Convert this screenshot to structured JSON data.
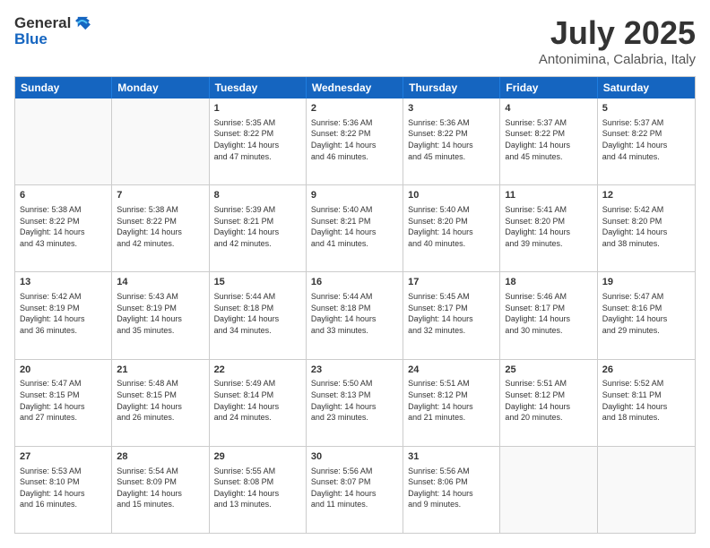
{
  "header": {
    "logo_line1": "General",
    "logo_line2": "Blue",
    "month": "July 2025",
    "location": "Antonimina, Calabria, Italy"
  },
  "days_of_week": [
    "Sunday",
    "Monday",
    "Tuesday",
    "Wednesday",
    "Thursday",
    "Friday",
    "Saturday"
  ],
  "weeks": [
    [
      {
        "day": "",
        "info": ""
      },
      {
        "day": "",
        "info": ""
      },
      {
        "day": "1",
        "info": "Sunrise: 5:35 AM\nSunset: 8:22 PM\nDaylight: 14 hours\nand 47 minutes."
      },
      {
        "day": "2",
        "info": "Sunrise: 5:36 AM\nSunset: 8:22 PM\nDaylight: 14 hours\nand 46 minutes."
      },
      {
        "day": "3",
        "info": "Sunrise: 5:36 AM\nSunset: 8:22 PM\nDaylight: 14 hours\nand 45 minutes."
      },
      {
        "day": "4",
        "info": "Sunrise: 5:37 AM\nSunset: 8:22 PM\nDaylight: 14 hours\nand 45 minutes."
      },
      {
        "day": "5",
        "info": "Sunrise: 5:37 AM\nSunset: 8:22 PM\nDaylight: 14 hours\nand 44 minutes."
      }
    ],
    [
      {
        "day": "6",
        "info": "Sunrise: 5:38 AM\nSunset: 8:22 PM\nDaylight: 14 hours\nand 43 minutes."
      },
      {
        "day": "7",
        "info": "Sunrise: 5:38 AM\nSunset: 8:22 PM\nDaylight: 14 hours\nand 42 minutes."
      },
      {
        "day": "8",
        "info": "Sunrise: 5:39 AM\nSunset: 8:21 PM\nDaylight: 14 hours\nand 42 minutes."
      },
      {
        "day": "9",
        "info": "Sunrise: 5:40 AM\nSunset: 8:21 PM\nDaylight: 14 hours\nand 41 minutes."
      },
      {
        "day": "10",
        "info": "Sunrise: 5:40 AM\nSunset: 8:20 PM\nDaylight: 14 hours\nand 40 minutes."
      },
      {
        "day": "11",
        "info": "Sunrise: 5:41 AM\nSunset: 8:20 PM\nDaylight: 14 hours\nand 39 minutes."
      },
      {
        "day": "12",
        "info": "Sunrise: 5:42 AM\nSunset: 8:20 PM\nDaylight: 14 hours\nand 38 minutes."
      }
    ],
    [
      {
        "day": "13",
        "info": "Sunrise: 5:42 AM\nSunset: 8:19 PM\nDaylight: 14 hours\nand 36 minutes."
      },
      {
        "day": "14",
        "info": "Sunrise: 5:43 AM\nSunset: 8:19 PM\nDaylight: 14 hours\nand 35 minutes."
      },
      {
        "day": "15",
        "info": "Sunrise: 5:44 AM\nSunset: 8:18 PM\nDaylight: 14 hours\nand 34 minutes."
      },
      {
        "day": "16",
        "info": "Sunrise: 5:44 AM\nSunset: 8:18 PM\nDaylight: 14 hours\nand 33 minutes."
      },
      {
        "day": "17",
        "info": "Sunrise: 5:45 AM\nSunset: 8:17 PM\nDaylight: 14 hours\nand 32 minutes."
      },
      {
        "day": "18",
        "info": "Sunrise: 5:46 AM\nSunset: 8:17 PM\nDaylight: 14 hours\nand 30 minutes."
      },
      {
        "day": "19",
        "info": "Sunrise: 5:47 AM\nSunset: 8:16 PM\nDaylight: 14 hours\nand 29 minutes."
      }
    ],
    [
      {
        "day": "20",
        "info": "Sunrise: 5:47 AM\nSunset: 8:15 PM\nDaylight: 14 hours\nand 27 minutes."
      },
      {
        "day": "21",
        "info": "Sunrise: 5:48 AM\nSunset: 8:15 PM\nDaylight: 14 hours\nand 26 minutes."
      },
      {
        "day": "22",
        "info": "Sunrise: 5:49 AM\nSunset: 8:14 PM\nDaylight: 14 hours\nand 24 minutes."
      },
      {
        "day": "23",
        "info": "Sunrise: 5:50 AM\nSunset: 8:13 PM\nDaylight: 14 hours\nand 23 minutes."
      },
      {
        "day": "24",
        "info": "Sunrise: 5:51 AM\nSunset: 8:12 PM\nDaylight: 14 hours\nand 21 minutes."
      },
      {
        "day": "25",
        "info": "Sunrise: 5:51 AM\nSunset: 8:12 PM\nDaylight: 14 hours\nand 20 minutes."
      },
      {
        "day": "26",
        "info": "Sunrise: 5:52 AM\nSunset: 8:11 PM\nDaylight: 14 hours\nand 18 minutes."
      }
    ],
    [
      {
        "day": "27",
        "info": "Sunrise: 5:53 AM\nSunset: 8:10 PM\nDaylight: 14 hours\nand 16 minutes."
      },
      {
        "day": "28",
        "info": "Sunrise: 5:54 AM\nSunset: 8:09 PM\nDaylight: 14 hours\nand 15 minutes."
      },
      {
        "day": "29",
        "info": "Sunrise: 5:55 AM\nSunset: 8:08 PM\nDaylight: 14 hours\nand 13 minutes."
      },
      {
        "day": "30",
        "info": "Sunrise: 5:56 AM\nSunset: 8:07 PM\nDaylight: 14 hours\nand 11 minutes."
      },
      {
        "day": "31",
        "info": "Sunrise: 5:56 AM\nSunset: 8:06 PM\nDaylight: 14 hours\nand 9 minutes."
      },
      {
        "day": "",
        "info": ""
      },
      {
        "day": "",
        "info": ""
      }
    ]
  ]
}
